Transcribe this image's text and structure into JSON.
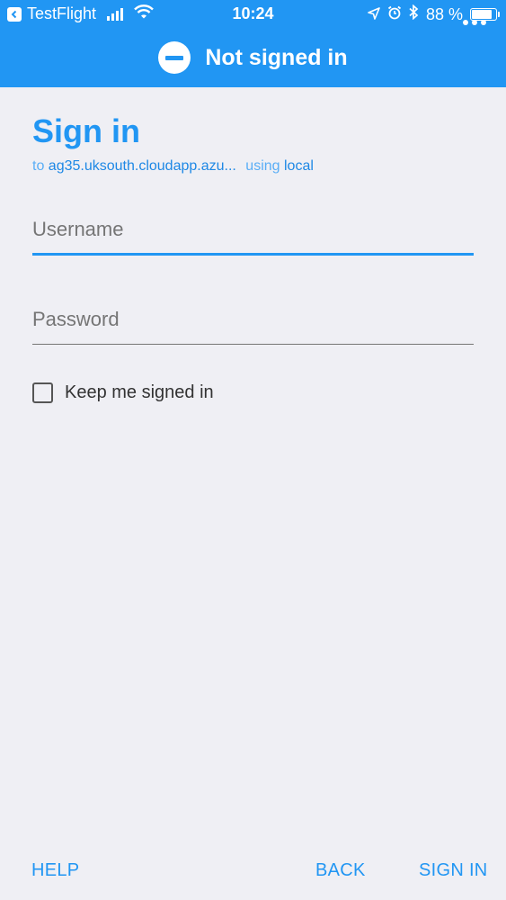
{
  "status_bar": {
    "back_app": "TestFlight",
    "time": "10:24",
    "battery": "88 %",
    "battery_level": 0.88
  },
  "header": {
    "title": "Not signed in",
    "status_icon": "no-entry-icon",
    "more_icon": "more-horizontal-icon"
  },
  "signin": {
    "title": "Sign in",
    "to_prefix": "to",
    "server": "ag35.uksouth.cloudapp.azu...",
    "using_text": "using",
    "provider": "local"
  },
  "form": {
    "username_placeholder": "Username",
    "password_placeholder": "Password",
    "keep_signed_in_label": "Keep me signed in",
    "keep_signed_in_checked": false
  },
  "footer": {
    "help_label": "HELP",
    "back_label": "BACK",
    "signin_label": "SIGN IN"
  },
  "colors": {
    "accent": "#2196f3",
    "background": "#efeff4"
  }
}
